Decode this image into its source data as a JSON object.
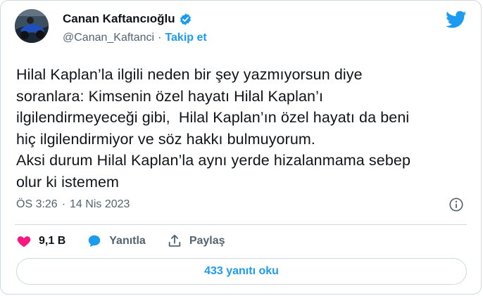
{
  "author": {
    "display_name": "Canan Kaftancıoğlu",
    "handle": "@Canan_Kaftanci",
    "separator": "·",
    "follow_label": "Takip et"
  },
  "tweet": {
    "text": "Hilal Kaplan’la ilgili neden bir şey yazmıyorsun diye\nsoranlara: Kimsenin özel hayatı Hilal Kaplan’ı\nilgilendirmeyeceği gibi,  Hilal Kaplan’ın özel hayatı da beni\nhiç ilgilendirmiyor ve söz hakkı bulmuyorum.\nAksi durum Hilal Kaplan’la aynı yerde hizalanmama sebep\nolur ki istemem",
    "time": "ÖS 3:26",
    "separator": "·",
    "date": "14 Nis 2023"
  },
  "actions": {
    "likes_count": "9,1 B",
    "reply_label": "Yanıtla",
    "share_label": "Paylaş"
  },
  "replies_button_label": "433 yanıtı oku",
  "colors": {
    "accent": "#1d9bf0",
    "like": "#f91880",
    "secondary_text": "#536471",
    "border": "#cfd9de"
  },
  "icons": [
    "verified-badge-icon",
    "twitter-bird-icon",
    "info-icon",
    "heart-icon",
    "reply-bubble-icon",
    "share-icon"
  ]
}
